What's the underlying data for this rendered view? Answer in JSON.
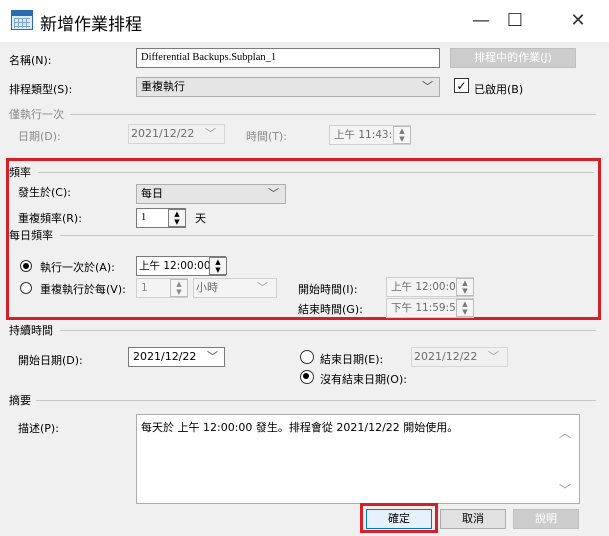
{
  "window": {
    "title": "新增作業排程",
    "minimize": "—",
    "maximize": "☐",
    "close": "✕"
  },
  "name": {
    "label": "名稱(N):",
    "value": "Differential Backups.Subplan_1",
    "jobs_button": "排程中的作業(J)"
  },
  "schedule_type": {
    "label": "排程類型(S):",
    "value": "重複執行",
    "enabled_label": "已啟用(B)",
    "enabled": true
  },
  "one_time": {
    "section": "僅執行一次",
    "date_label": "日期(D):",
    "date_value": "2021/12/22",
    "time_label": "時間(T):",
    "time_value": "上午 11:43:"
  },
  "frequency": {
    "section": "頻率",
    "occurs_label": "發生於(C):",
    "occurs_value": "每日",
    "recurs_label": "重複頻率(R):",
    "recurs_value": "1",
    "recurs_unit": "天"
  },
  "daily": {
    "section": "每日頻率",
    "once_label": "執行一次於(A):",
    "once_value": "上午 12:00:00",
    "every_label": "重複執行於每(V):",
    "every_value": "1",
    "every_unit": "小時",
    "start_label": "開始時間(I):",
    "start_value": "上午 12:00:00",
    "end_label": "結束時間(G):",
    "end_value": "下午 11:59:59"
  },
  "duration": {
    "section": "持續時間",
    "start_label": "開始日期(D):",
    "start_value": "2021/12/22",
    "end_label": "結束日期(E):",
    "end_value": "2021/12/22",
    "no_end_label": "沒有結束日期(O):"
  },
  "summary": {
    "section": "摘要",
    "desc_label": "描述(P):",
    "desc_value": "每天於 上午 12:00:00 發生。排程會從 2021/12/22 開始使用。"
  },
  "buttons": {
    "ok": "確定",
    "cancel": "取消",
    "help": "說明"
  },
  "colors": {
    "highlight": "#d61f26",
    "background": "#f0f0f0"
  }
}
